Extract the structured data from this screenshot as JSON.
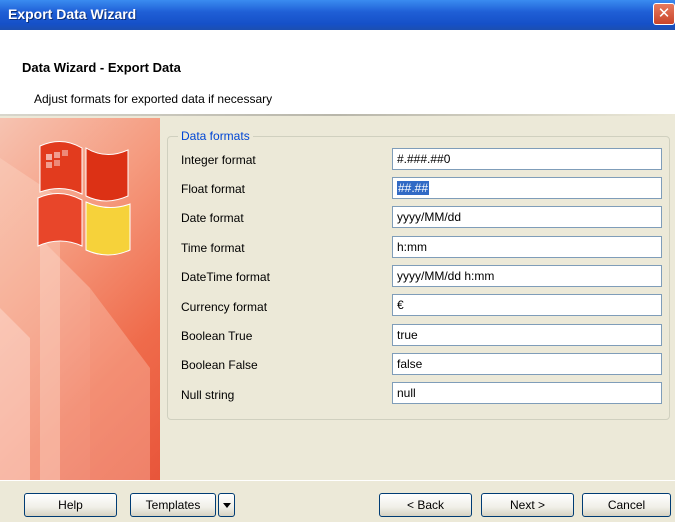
{
  "window": {
    "title": "Export Data Wizard",
    "close_glyph": "✕"
  },
  "header": {
    "title": "Data Wizard - Export Data",
    "subtitle": "Adjust formats for exported data if necessary"
  },
  "group": {
    "legend": "Data formats"
  },
  "fields": [
    {
      "label": "Integer format",
      "value": "#.###.##0"
    },
    {
      "label": "Float format",
      "value": "##.##",
      "selected": true
    },
    {
      "label": "Date format",
      "value": "yyyy/MM/dd"
    },
    {
      "label": "Time format",
      "value": "h:mm"
    },
    {
      "label": "DateTime format",
      "value": "yyyy/MM/dd h:mm"
    },
    {
      "label": "Currency format",
      "value": "€"
    },
    {
      "label": "Boolean True",
      "value": "true"
    },
    {
      "label": "Boolean False",
      "value": "false"
    },
    {
      "label": "Null string",
      "value": "null"
    }
  ],
  "buttons": {
    "help": "Help",
    "templates": "Templates",
    "back": "< Back",
    "next": "Next >",
    "cancel": "Cancel"
  },
  "icons": {
    "logo": "windows-flag-logo-icon",
    "dropdown": "chevron-down-icon"
  },
  "colors": {
    "titlebar": "#1f5fd6",
    "legend": "#0046d5",
    "selection": "#316ac5",
    "sidebar": "#ef6b4b"
  }
}
